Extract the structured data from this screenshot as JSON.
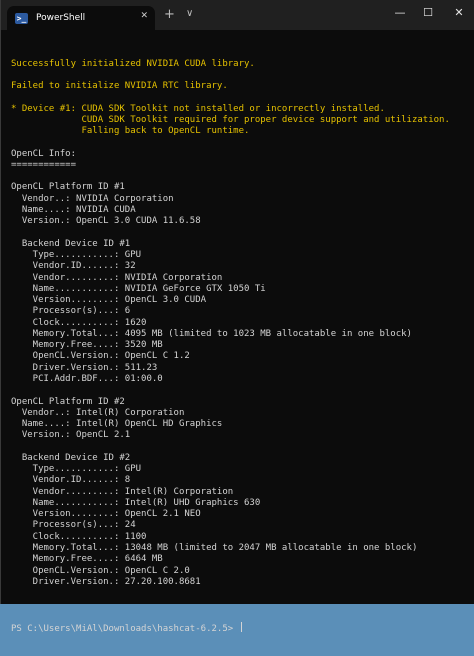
{
  "window": {
    "tab_title": "PowerShell",
    "tab_icon_glyph": ">_",
    "new_tab_glyph": "+",
    "dropdown_glyph": "∨",
    "close_tab_glyph": "✕",
    "minimize_glyph": "—",
    "maximize_glyph": "☐",
    "close_glyph": "✕"
  },
  "colors": {
    "background": "#0c0c0c",
    "warning_text": "#e5c100",
    "normal_text": "#d4d4d4"
  },
  "terminal": {
    "lines": [
      {
        "text": "Successfully initialized NVIDIA CUDA library.",
        "color": "yellow"
      },
      {
        "text": "",
        "color": "white"
      },
      {
        "text": "Failed to initialize NVIDIA RTC library.",
        "color": "yellow"
      },
      {
        "text": "",
        "color": "white"
      },
      {
        "text": "* Device #1: CUDA SDK Toolkit not installed or incorrectly installed.",
        "color": "yellow"
      },
      {
        "text": "             CUDA SDK Toolkit required for proper device support and utilization.",
        "color": "yellow"
      },
      {
        "text": "             Falling back to OpenCL runtime.",
        "color": "yellow"
      },
      {
        "text": "",
        "color": "white"
      },
      {
        "text": "OpenCL Info:",
        "color": "white"
      },
      {
        "text": "============",
        "color": "white"
      },
      {
        "text": "",
        "color": "white"
      },
      {
        "text": "OpenCL Platform ID #1",
        "color": "white"
      },
      {
        "text": "  Vendor..: NVIDIA Corporation",
        "color": "white"
      },
      {
        "text": "  Name....: NVIDIA CUDA",
        "color": "white"
      },
      {
        "text": "  Version.: OpenCL 3.0 CUDA 11.6.58",
        "color": "white"
      },
      {
        "text": "",
        "color": "white"
      },
      {
        "text": "  Backend Device ID #1",
        "color": "white"
      },
      {
        "text": "    Type...........: GPU",
        "color": "white"
      },
      {
        "text": "    Vendor.ID......: 32",
        "color": "white"
      },
      {
        "text": "    Vendor.........: NVIDIA Corporation",
        "color": "white"
      },
      {
        "text": "    Name...........: NVIDIA GeForce GTX 1050 Ti",
        "color": "white"
      },
      {
        "text": "    Version........: OpenCL 3.0 CUDA",
        "color": "white"
      },
      {
        "text": "    Processor(s)...: 6",
        "color": "white"
      },
      {
        "text": "    Clock..........: 1620",
        "color": "white"
      },
      {
        "text": "    Memory.Total...: 4095 MB (limited to 1023 MB allocatable in one block)",
        "color": "white"
      },
      {
        "text": "    Memory.Free....: 3520 MB",
        "color": "white"
      },
      {
        "text": "    OpenCL.Version.: OpenCL C 1.2",
        "color": "white"
      },
      {
        "text": "    Driver.Version.: 511.23",
        "color": "white"
      },
      {
        "text": "    PCI.Addr.BDF...: 01:00.0",
        "color": "white"
      },
      {
        "text": "",
        "color": "white"
      },
      {
        "text": "OpenCL Platform ID #2",
        "color": "white"
      },
      {
        "text": "  Vendor..: Intel(R) Corporation",
        "color": "white"
      },
      {
        "text": "  Name....: Intel(R) OpenCL HD Graphics",
        "color": "white"
      },
      {
        "text": "  Version.: OpenCL 2.1",
        "color": "white"
      },
      {
        "text": "",
        "color": "white"
      },
      {
        "text": "  Backend Device ID #2",
        "color": "white"
      },
      {
        "text": "    Type...........: GPU",
        "color": "white"
      },
      {
        "text": "    Vendor.ID......: 8",
        "color": "white"
      },
      {
        "text": "    Vendor.........: Intel(R) Corporation",
        "color": "white"
      },
      {
        "text": "    Name...........: Intel(R) UHD Graphics 630",
        "color": "white"
      },
      {
        "text": "    Version........: OpenCL 2.1 NEO",
        "color": "white"
      },
      {
        "text": "    Processor(s)...: 24",
        "color": "white"
      },
      {
        "text": "    Clock..........: 1100",
        "color": "white"
      },
      {
        "text": "    Memory.Total...: 13048 MB (limited to 2047 MB allocatable in one block)",
        "color": "white"
      },
      {
        "text": "    Memory.Free....: 6464 MB",
        "color": "white"
      },
      {
        "text": "    OpenCL.Version.: OpenCL C 2.0",
        "color": "white"
      },
      {
        "text": "    Driver.Version.: 27.20.100.8681",
        "color": "white"
      },
      {
        "text": "",
        "color": "white"
      }
    ],
    "prompt": "PS C:\\Users\\MiAl\\Downloads\\hashcat-6.2.5> "
  }
}
